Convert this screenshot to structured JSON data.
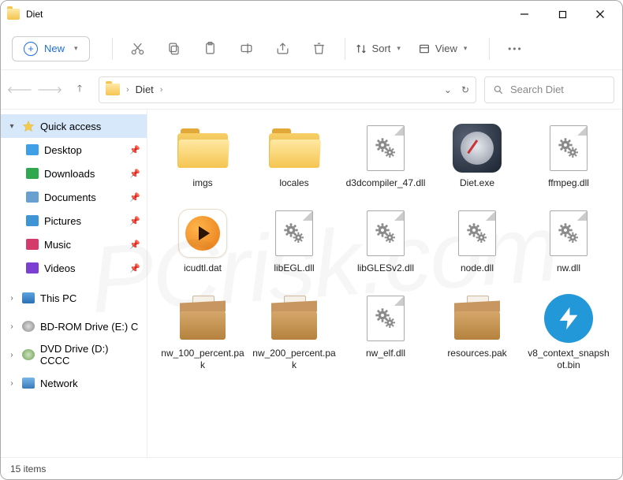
{
  "window": {
    "title": "Diet"
  },
  "toolbar": {
    "new_label": "New",
    "sort_label": "Sort",
    "view_label": "View"
  },
  "breadcrumb": {
    "path": "Diet"
  },
  "search": {
    "placeholder": "Search Diet"
  },
  "sidebar": {
    "quick_access": "Quick access",
    "items": [
      {
        "label": "Desktop",
        "color": "#3fa0e8"
      },
      {
        "label": "Downloads",
        "color": "#2fa84f"
      },
      {
        "label": "Documents",
        "color": "#6aa0cf"
      },
      {
        "label": "Pictures",
        "color": "#3f94d6"
      },
      {
        "label": "Music",
        "color": "#d43b6b"
      },
      {
        "label": "Videos",
        "color": "#7b3fd4"
      }
    ],
    "this_pc": "This PC",
    "bd_rom": "BD-ROM Drive (E:) C",
    "dvd": "DVD Drive (D:) CCCC",
    "network": "Network"
  },
  "files": [
    {
      "name": "imgs",
      "type": "folder"
    },
    {
      "name": "locales",
      "type": "folder"
    },
    {
      "name": "d3dcompiler_47.dll",
      "type": "dll"
    },
    {
      "name": "Diet.exe",
      "type": "exe"
    },
    {
      "name": "ffmpeg.dll",
      "type": "dll"
    },
    {
      "name": "icudtl.dat",
      "type": "dat"
    },
    {
      "name": "libEGL.dll",
      "type": "dll"
    },
    {
      "name": "libGLESv2.dll",
      "type": "dll"
    },
    {
      "name": "node.dll",
      "type": "dll"
    },
    {
      "name": "nw.dll",
      "type": "dll"
    },
    {
      "name": "nw_100_percent.pak",
      "type": "pak"
    },
    {
      "name": "nw_200_percent.pak",
      "type": "pak"
    },
    {
      "name": "nw_elf.dll",
      "type": "dll"
    },
    {
      "name": "resources.pak",
      "type": "pak"
    },
    {
      "name": "v8_context_snapshot.bin",
      "type": "bolt"
    }
  ],
  "status": {
    "item_count": "15 items"
  }
}
